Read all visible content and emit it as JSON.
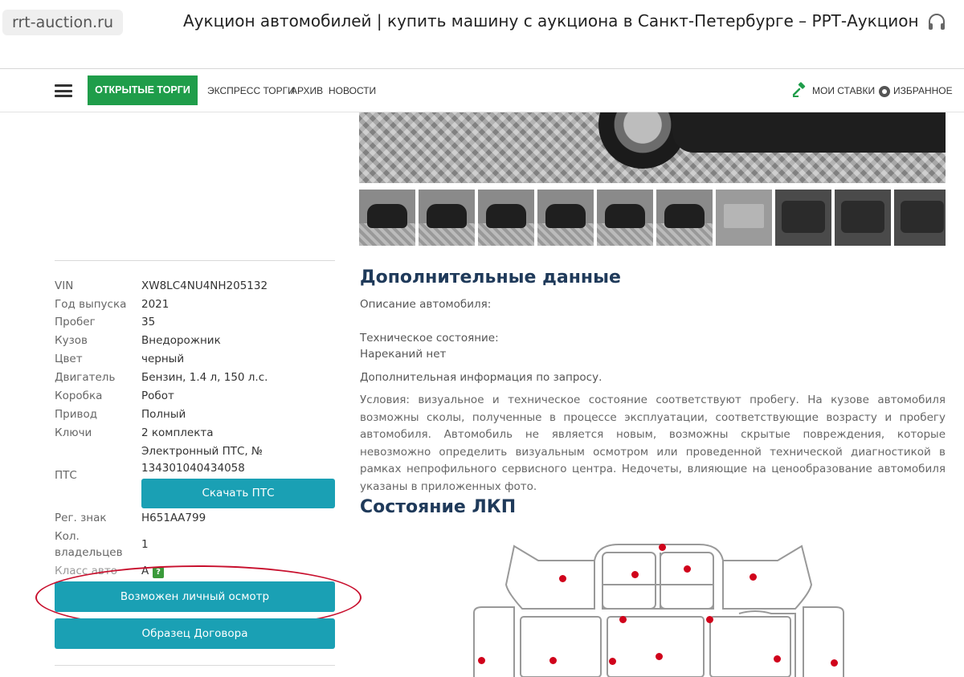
{
  "browser": {
    "url": "rrt-auction.ru",
    "title": "Аукцион автомобилей | купить машину с аукциона в Санкт-Петербурге – РРТ-Аукцион"
  },
  "nav": {
    "active": "ОТКРЫТЫЕ ТОРГИ",
    "links": [
      "ЭКСПРЕСС ТОРГИ",
      "АРХИВ",
      "НОВОСТИ"
    ],
    "my_bids": "МОИ СТАВКИ",
    "favorites": "ИЗБРАННОЕ"
  },
  "specs": [
    {
      "label": "VIN",
      "value": "XW8LC4NU4NH205132"
    },
    {
      "label": "Год выпуска",
      "value": "2021"
    },
    {
      "label": "Пробег",
      "value": "35"
    },
    {
      "label": "Кузов",
      "value": "Внедорожник"
    },
    {
      "label": "Цвет",
      "value": "черный"
    },
    {
      "label": "Двигатель",
      "value": "Бензин, 1.4 л, 150 л.с."
    },
    {
      "label": "Коробка",
      "value": "Робот"
    },
    {
      "label": "Привод",
      "value": "Полный"
    },
    {
      "label": "Ключи",
      "value": "2 комплекта"
    }
  ],
  "pts": {
    "label": "ПТС",
    "value_line1": "Электронный ПТС, №",
    "value_line2": "134301040434058",
    "download_button": "Скачать ПТС"
  },
  "reg": {
    "label": "Рег. знак",
    "value": "Н651АА799"
  },
  "owners": {
    "label_line1": "Кол.",
    "label_line2": "владельцев",
    "value": "1"
  },
  "eco": {
    "label": "Класс авто",
    "value": "А",
    "badge": "?"
  },
  "buttons": {
    "inspection": "Возможен личный осмотр",
    "contract": "Образец Договора"
  },
  "extra": {
    "heading": "Дополнительные данные",
    "description_label": "Описание автомобиля:",
    "tech_label": "Техническое состояние:",
    "tech_value": "Нареканий нет",
    "more_info": "Дополнительная информация по запросу.",
    "conditions": "Условия: визуальное и техническое состояние соответствуют пробегу. На кузове автомобиля возможны сколы, полученные в процессе эксплуатации, соответствующие возрасту и пробегу автомобиля. Автомобиль не является новым, возможны скрытые повреждения, которые невозможно определить визуальным осмотром или проведенной технической диагностикой в рамках непрофильного сервисного центра. Недочеты, влияющие на ценообразование автомобиля указаны в приложенных фото."
  },
  "paint": {
    "heading": "Состояние ЛКП"
  },
  "icons": {
    "menu": "hamburger-icon",
    "headphones": "headphones-icon",
    "gavel": "gavel-icon",
    "favorites": "star-circle-icon"
  },
  "colors": {
    "active_nav": "#1f9d4a",
    "button": "#1aa0b4",
    "heading": "#1f3a5a",
    "damage_dot": "#d0021b",
    "annotation": "#c8102e"
  }
}
